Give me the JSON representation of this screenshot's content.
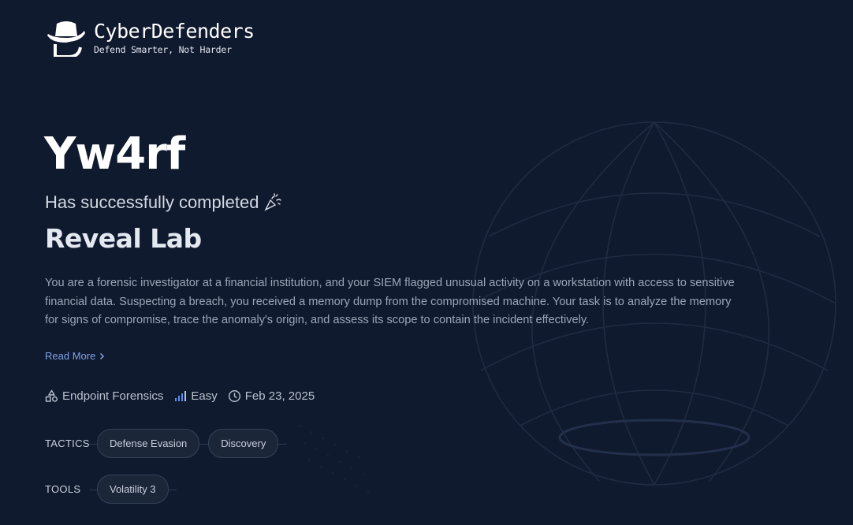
{
  "brand": {
    "name": "CyberDefenders",
    "tagline": "Defend Smarter, Not Harder"
  },
  "certificate": {
    "username": "Yw4rf",
    "completed_text": "Has successfully completed",
    "lab_title": "Reveal Lab",
    "description": "You are a forensic investigator at a financial institution, and your SIEM flagged unusual activity on a workstation with access to sensitive financial data. Suspecting a breach, you received a memory dump from the compromised machine. Your task is to analyze the memory for signs of compromise, trace the anomaly's origin, and assess its scope to contain the incident effectively.",
    "read_more": "Read More",
    "read_more_icon": "chevron-right-icon"
  },
  "meta": {
    "category": "Endpoint Forensics",
    "category_icon": "shapes-icon",
    "difficulty": "Easy",
    "difficulty_icon": "signal-bars-icon",
    "date": "Feb 23, 2025",
    "date_icon": "clock-icon"
  },
  "tactics": {
    "label": "TACTICS",
    "items": [
      "Defense Evasion",
      "Discovery"
    ]
  },
  "tools": {
    "label": "TOOLS",
    "items": [
      "Volatility 3"
    ]
  },
  "colors": {
    "background": "#101a2e",
    "accent_link": "#7fa0e8",
    "chip_bg": "#1c2639",
    "difficulty_bars": "#5b8cf0"
  }
}
